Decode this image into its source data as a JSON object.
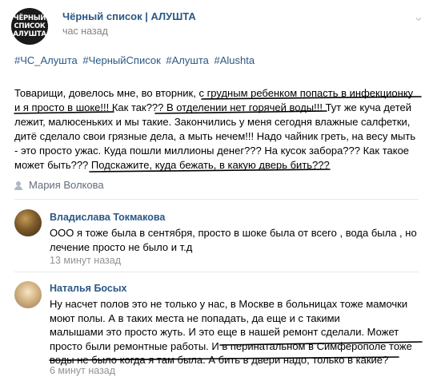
{
  "post": {
    "group_name": "Чёрный список | АЛУШТА",
    "avatar_lines": [
      "ЧЁРНЫЙ",
      "СПИСОК",
      "АЛУШТА"
    ],
    "time": "час назад",
    "more_icon": "chevron-down-icon",
    "hashtags": [
      "#ЧС_Алушта",
      "#ЧерныйСписок",
      "#Алушта",
      "#Alushta"
    ],
    "text_lines": [
      "Товарищи, довелось мне, во вторник, с грудным ребенком попасть в инфекционку",
      "и я просто в шоке!!! Как так??? В отделении нет горячей воды!!! Тут же куча детей",
      "лежит, малюсеньких и мы такие. Закончились у меня сегодня влажные салфетки,",
      "дитё сделало свои грязные дела, а мыть нечем!!! Надо чайник греть, на весу мыть",
      "- это просто ужас. Куда пошли миллионы денег??? На кусок забора??? Как такое",
      "может быть??? Подскажите, куда бежать, в какую дверь бить???"
    ],
    "author_signature": "Мария Волкова"
  },
  "comments": [
    {
      "author": "Владислава Токмакова",
      "text_lines": [
        "ООО я тоже была в сентября, просто в шоке была от всего , вода была , но",
        "лечение просто не было и т.д"
      ],
      "time": "13 минут назад"
    },
    {
      "author": "Наталья Босых",
      "text_lines": [
        "Ну насчет полов это не только у нас, в Москве в больницах тоже мамочки",
        "моют полы. А в таких места не попадать, да еще и с такими",
        "малышами это просто жуть. И это еще в нашей ремонт сделали. Может",
        "просто были ремонтные работы. И в перинатальном в Симферополе тоже",
        "воды не было когда я там была. А бить в двери надо, только в какие?"
      ],
      "time": "6 минут назад"
    }
  ],
  "colors": {
    "link": "#2a5885",
    "meta": "#828282",
    "divider": "#e7e8ec",
    "underline": "#000000"
  }
}
